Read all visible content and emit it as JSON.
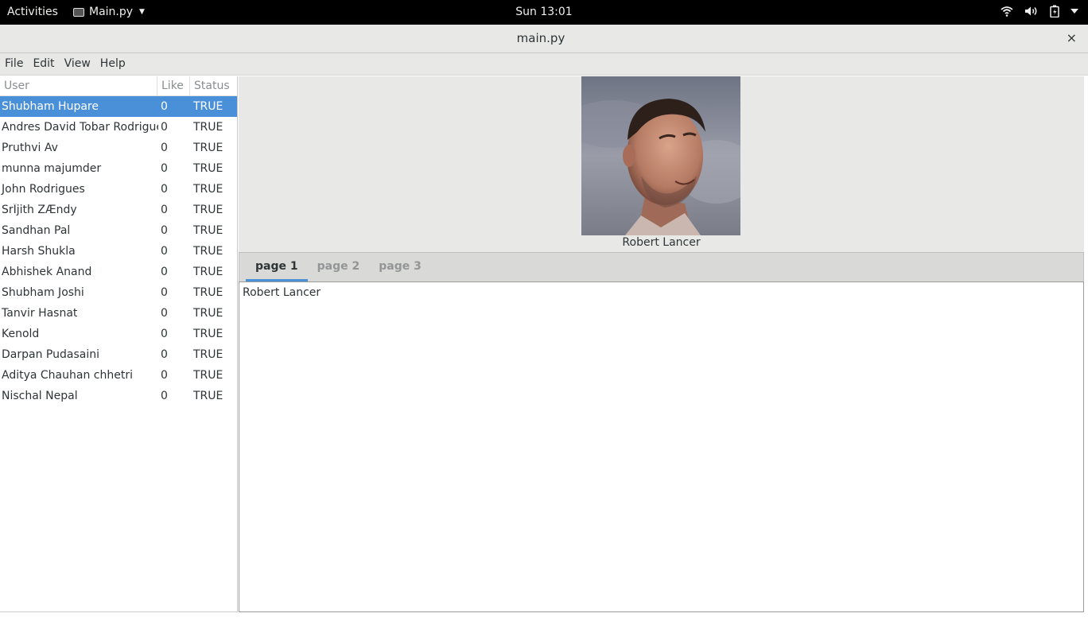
{
  "topbar": {
    "activities": "Activities",
    "app_name": "Main.py",
    "clock": "Sun 13:01"
  },
  "window": {
    "title": "main.py",
    "close": "×"
  },
  "menubar": {
    "items": [
      "File",
      "Edit",
      "View",
      "Help"
    ]
  },
  "tree": {
    "columns": [
      "User",
      "Like",
      "Status"
    ],
    "rows": [
      {
        "user": "Shubham Hupare",
        "like": "0",
        "status": "TRUE"
      },
      {
        "user": "Andres David Tobar Rodriguez",
        "like": "0",
        "status": "TRUE"
      },
      {
        "user": "Pruthvi Av",
        "like": "0",
        "status": "TRUE"
      },
      {
        "user": "munna majumder",
        "like": "0",
        "status": "TRUE"
      },
      {
        "user": "John Rodrigues",
        "like": "0",
        "status": "TRUE"
      },
      {
        "user": "SrÎjith ZÆndy",
        "like": "0",
        "status": "TRUE"
      },
      {
        "user": "Sandhan Pal",
        "like": "0",
        "status": "TRUE"
      },
      {
        "user": "Harsh Shukla",
        "like": "0",
        "status": "TRUE"
      },
      {
        "user": "Abhishek Anand",
        "like": "0",
        "status": "TRUE"
      },
      {
        "user": "Shubham Joshi",
        "like": "0",
        "status": "TRUE"
      },
      {
        "user": "Tanvir Hasnat",
        "like": "0",
        "status": "TRUE"
      },
      {
        "user": "Kenold",
        "like": "0",
        "status": "TRUE"
      },
      {
        "user": "Darpan Pudasaini",
        "like": "0",
        "status": "TRUE"
      },
      {
        "user": "Aditya Chauhan chhetri",
        "like": "0",
        "status": "TRUE"
      },
      {
        "user": "Nischal Nepal",
        "like": "0",
        "status": "TRUE"
      }
    ]
  },
  "profile": {
    "caption": "Robert Lancer"
  },
  "notebook": {
    "tabs": [
      "page 1",
      "page 2",
      "page 3"
    ],
    "content": "Robert Lancer"
  },
  "colors": {
    "selection": "#4a90d9",
    "topbar": "#000000",
    "window_bg": "#e8e8e7"
  }
}
